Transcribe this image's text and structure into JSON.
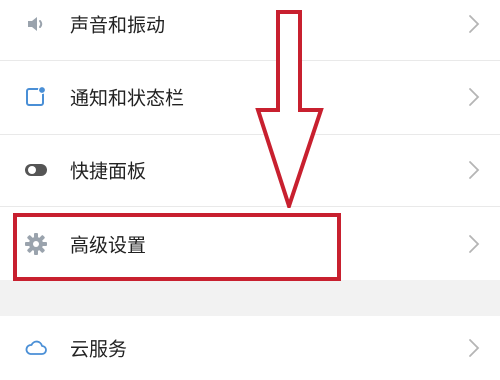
{
  "settings": {
    "items": [
      {
        "label": "声音和振动",
        "icon": "speaker-icon"
      },
      {
        "label": "通知和状态栏",
        "icon": "notification-icon"
      },
      {
        "label": "快捷面板",
        "icon": "toggle-icon"
      },
      {
        "label": "高级设置",
        "icon": "gear-icon"
      },
      {
        "label": "云服务",
        "icon": "cloud-icon"
      }
    ]
  },
  "colors": {
    "icon": "#4a8fd6",
    "toggle_icon": "#555555",
    "annotation": "#c8202f",
    "chevron": "#b5b5b5",
    "section_gap": "#f2f2f2"
  }
}
